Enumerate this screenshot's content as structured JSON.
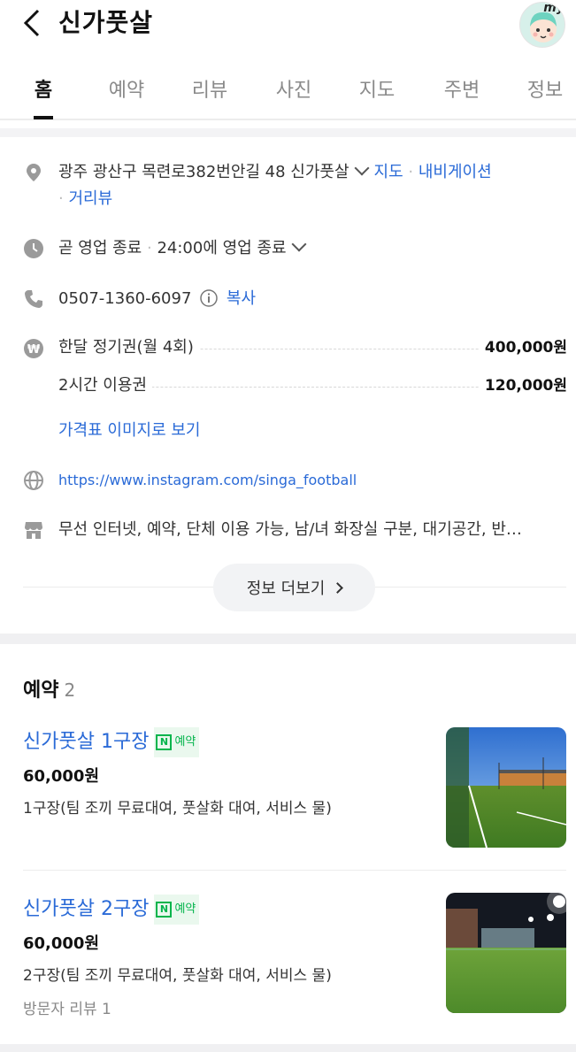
{
  "header": {
    "title": "신가풋살",
    "avatar_label": "my"
  },
  "tabs": [
    {
      "label": "홈",
      "active": true
    },
    {
      "label": "예약"
    },
    {
      "label": "리뷰"
    },
    {
      "label": "사진"
    },
    {
      "label": "지도"
    },
    {
      "label": "주변"
    },
    {
      "label": "정보"
    }
  ],
  "info": {
    "address": "광주 광산구 목련로382번안길 48 신가풋살",
    "map_link": "지도",
    "nav_link": "내비게이션",
    "street_view_link": "거리뷰",
    "hours_status": "곧 영업 종료",
    "hours_detail": "24:00에 영업 종료",
    "phone": "0507-1360-6097",
    "copy_label": "복사",
    "prices": [
      {
        "name": "한달 정기권(월 4회)",
        "value": "400,000원"
      },
      {
        "name": "2시간 이용권",
        "value": "120,000원"
      }
    ],
    "price_image_link": "가격표 이미지로 보기",
    "website": "https://www.instagram.com/singa_football",
    "amenities": "무선 인터넷, 예약, 단체 이용 가능, 남/녀 화장실 구분, 대기공간, 반…",
    "more_button": "정보 더보기"
  },
  "reservation": {
    "title": "예약",
    "count": "2",
    "items": [
      {
        "name": "신가풋살 1구장",
        "badge": "예약",
        "badge_icon": "N",
        "price": "60,000원",
        "desc": "1구장(팀 조끼 무료대여, 풋살화 대여, 서비스 물)"
      },
      {
        "name": "신가풋살 2구장",
        "badge": "예약",
        "badge_icon": "N",
        "price": "60,000원",
        "desc": "2구장(팀 조끼 무료대여, 풋살화 대여, 서비스 물)",
        "review": "방문자 리뷰 1"
      }
    ]
  },
  "colors": {
    "link": "#2a6ad7",
    "npay_green": "#03b44c"
  }
}
